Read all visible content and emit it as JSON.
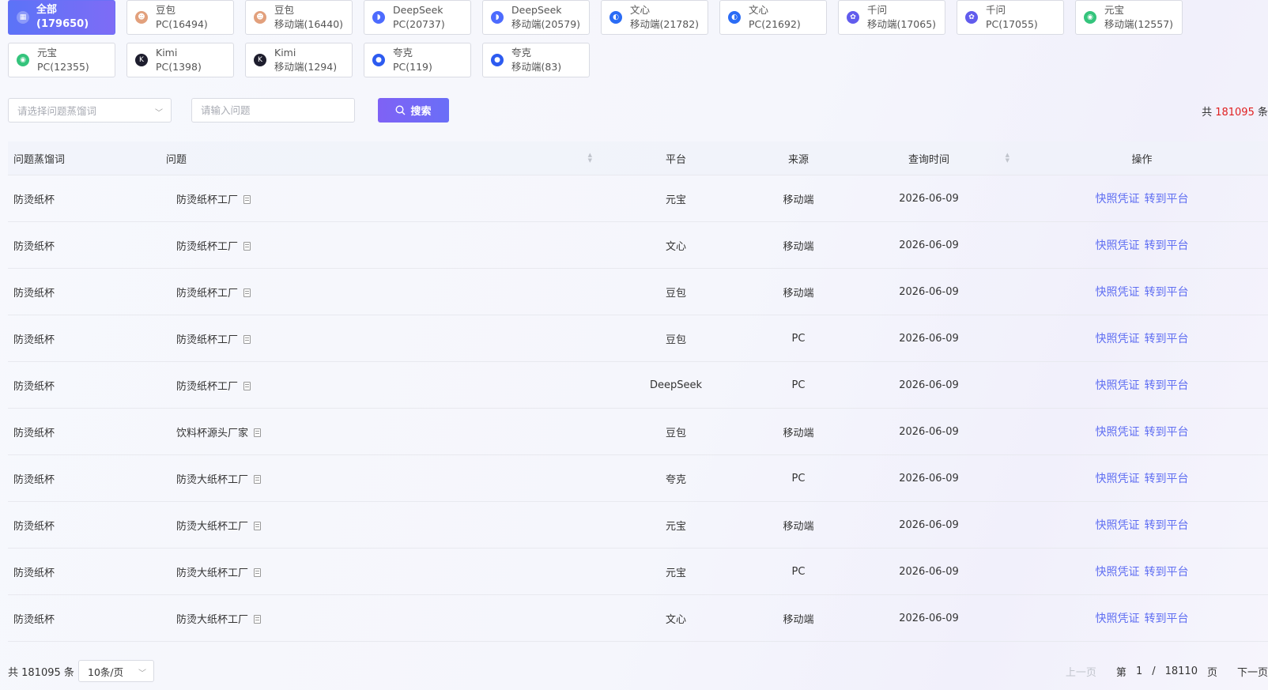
{
  "tabs": [
    {
      "name": "全部",
      "count": "(179650)",
      "icon": "grid-icon",
      "color": "#ffffff",
      "glyph": "▦",
      "active": true
    },
    {
      "name": "豆包",
      "count": "PC(16494)",
      "icon": "doubao-icon",
      "color": "#e2a07c",
      "glyph": "☻"
    },
    {
      "name": "豆包",
      "count": "移动端(16440)",
      "icon": "doubao-icon",
      "color": "#e2a07c",
      "glyph": "☻"
    },
    {
      "name": "DeepSeek",
      "count": "PC(20737)",
      "icon": "deepseek-icon",
      "color": "#4d6bfe",
      "glyph": "◗"
    },
    {
      "name": "DeepSeek",
      "count": "移动端(20579)",
      "icon": "deepseek-icon",
      "color": "#4d6bfe",
      "glyph": "◗"
    },
    {
      "name": "文心",
      "count": "移动端(21782)",
      "icon": "wenxin-icon",
      "color": "#2b6cf5",
      "glyph": "◐"
    },
    {
      "name": "文心",
      "count": "PC(21692)",
      "icon": "wenxin-icon",
      "color": "#2b6cf5",
      "glyph": "◐"
    },
    {
      "name": "千问",
      "count": "移动端(17065)",
      "icon": "qianwen-icon",
      "color": "#615ced",
      "glyph": "✿"
    },
    {
      "name": "千问",
      "count": "PC(17055)",
      "icon": "qianwen-icon",
      "color": "#615ced",
      "glyph": "✿"
    },
    {
      "name": "元宝",
      "count": "移动端(12557)",
      "icon": "yuanbao-icon",
      "color": "#34c47c",
      "glyph": "◉"
    },
    {
      "name": "元宝",
      "count": "PC(12355)",
      "icon": "yuanbao-icon",
      "color": "#34c47c",
      "glyph": "◉"
    },
    {
      "name": "Kimi",
      "count": "PC(1398)",
      "icon": "kimi-icon",
      "color": "#1e1e2e",
      "glyph": "K"
    },
    {
      "name": "Kimi",
      "count": "移动端(1294)",
      "icon": "kimi-icon",
      "color": "#1e1e2e",
      "glyph": "K"
    },
    {
      "name": "夸克",
      "count": "PC(119)",
      "icon": "quark-icon",
      "color": "#2d5bf0",
      "glyph": "●"
    },
    {
      "name": "夸克",
      "count": "移动端(83)",
      "icon": "quark-icon",
      "color": "#2d5bf0",
      "glyph": "●"
    }
  ],
  "filters": {
    "keyword_placeholder": "请选择问题蒸馏词",
    "question_placeholder": "请输入问题",
    "search_label": "搜索",
    "total_prefix": "共 ",
    "total_count": "181095",
    "total_suffix": " 条"
  },
  "table": {
    "headers": {
      "keyword": "问题蒸馏词",
      "question": "问题",
      "platform": "平台",
      "source": "来源",
      "time": "查询时间",
      "action": "操作"
    },
    "action_labels": {
      "snapshot": "快照凭证",
      "goto": "转到平台"
    },
    "rows": [
      {
        "keyword": "防烫纸杯",
        "question": "防烫纸杯工厂",
        "platform": "元宝",
        "source": "移动端",
        "time": "2026-06-09"
      },
      {
        "keyword": "防烫纸杯",
        "question": "防烫纸杯工厂",
        "platform": "文心",
        "source": "移动端",
        "time": "2026-06-09"
      },
      {
        "keyword": "防烫纸杯",
        "question": "防烫纸杯工厂",
        "platform": "豆包",
        "source": "移动端",
        "time": "2026-06-09"
      },
      {
        "keyword": "防烫纸杯",
        "question": "防烫纸杯工厂",
        "platform": "豆包",
        "source": "PC",
        "time": "2026-06-09"
      },
      {
        "keyword": "防烫纸杯",
        "question": "防烫纸杯工厂",
        "platform": "DeepSeek",
        "source": "PC",
        "time": "2026-06-09"
      },
      {
        "keyword": "防烫纸杯",
        "question": "饮料杯源头厂家",
        "platform": "豆包",
        "source": "移动端",
        "time": "2026-06-09"
      },
      {
        "keyword": "防烫纸杯",
        "question": "防烫大纸杯工厂",
        "platform": "夸克",
        "source": "PC",
        "time": "2026-06-09"
      },
      {
        "keyword": "防烫纸杯",
        "question": "防烫大纸杯工厂",
        "platform": "元宝",
        "source": "移动端",
        "time": "2026-06-09"
      },
      {
        "keyword": "防烫纸杯",
        "question": "防烫大纸杯工厂",
        "platform": "元宝",
        "source": "PC",
        "time": "2026-06-09"
      },
      {
        "keyword": "防烫纸杯",
        "question": "防烫大纸杯工厂",
        "platform": "文心",
        "source": "移动端",
        "time": "2026-06-09"
      }
    ]
  },
  "footer": {
    "total_label": "共 181095 条",
    "page_size": "10条/页",
    "prev_label": "上一页",
    "page_prefix": "第",
    "current_page": "1",
    "page_sep": "/",
    "total_pages": "18110",
    "page_suffix": "页",
    "next_label": "下一页"
  }
}
